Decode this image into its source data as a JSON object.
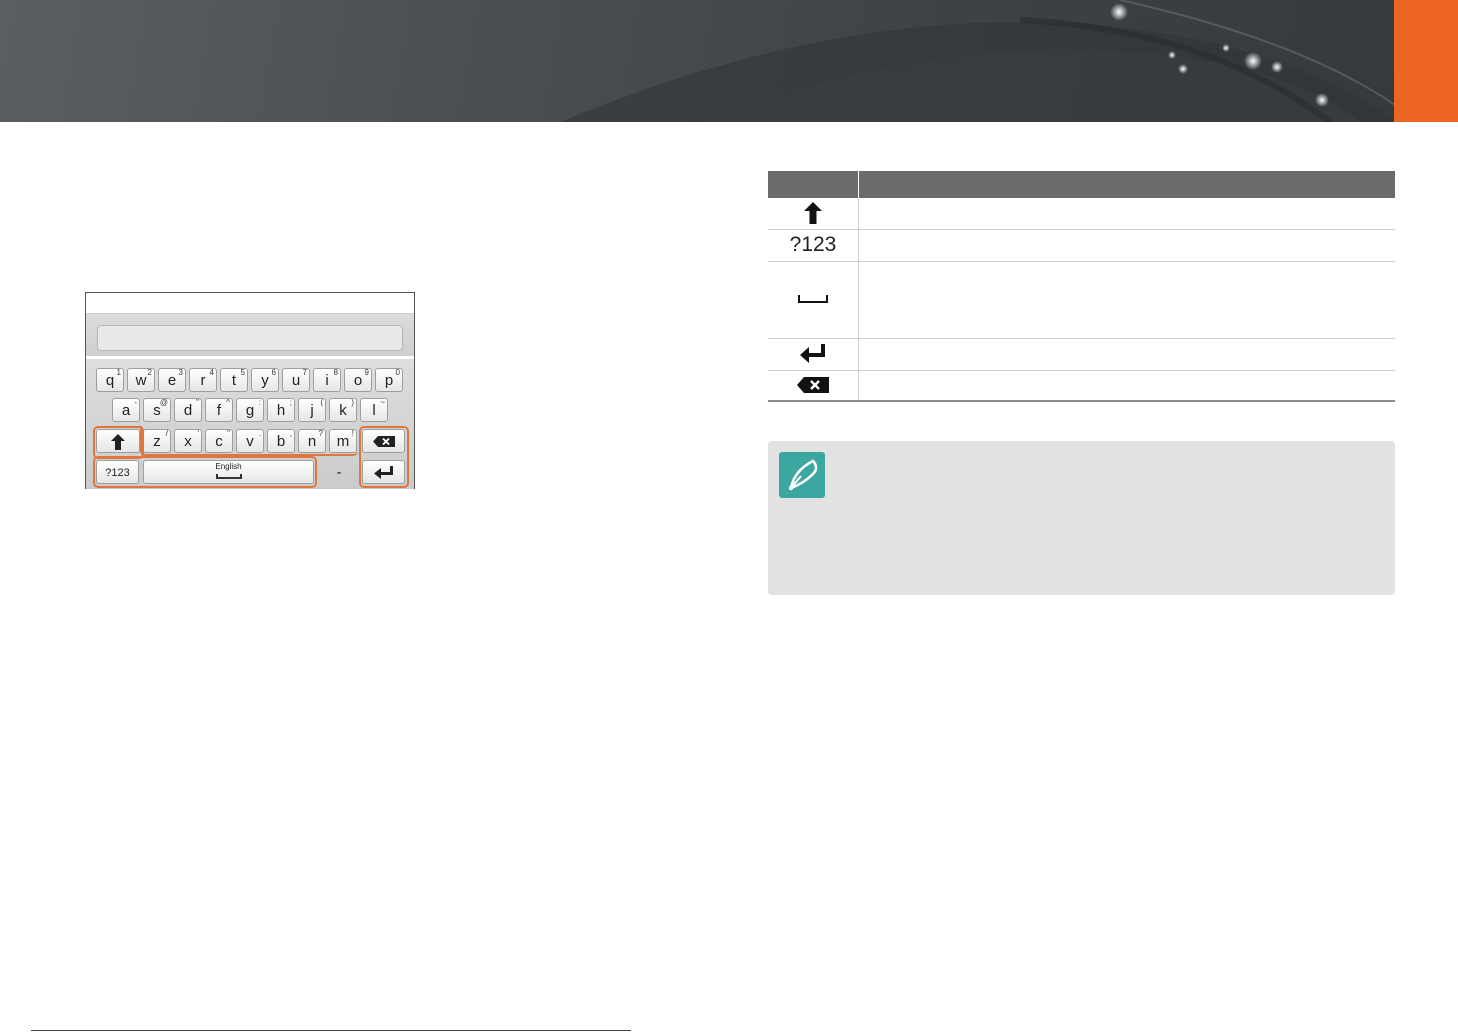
{
  "keyboard": {
    "row1": [
      {
        "key": "q",
        "sup": "1"
      },
      {
        "key": "w",
        "sup": "2"
      },
      {
        "key": "e",
        "sup": "3"
      },
      {
        "key": "r",
        "sup": "4"
      },
      {
        "key": "t",
        "sup": "5"
      },
      {
        "key": "y",
        "sup": "6"
      },
      {
        "key": "u",
        "sup": "7"
      },
      {
        "key": "i",
        "sup": "8"
      },
      {
        "key": "o",
        "sup": "9"
      },
      {
        "key": "p",
        "sup": "0"
      }
    ],
    "row2": [
      {
        "key": "a",
        "sup": "-"
      },
      {
        "key": "s",
        "sup": "@"
      },
      {
        "key": "d",
        "sup": "\""
      },
      {
        "key": "f",
        "sup": "^"
      },
      {
        "key": "g",
        "sup": ":"
      },
      {
        "key": "h",
        "sup": ";"
      },
      {
        "key": "j",
        "sup": "("
      },
      {
        "key": "k",
        "sup": ")"
      },
      {
        "key": "l",
        "sup": "~"
      }
    ],
    "row3": [
      {
        "key": "z",
        "sup": "/"
      },
      {
        "key": "x",
        "sup": "'"
      },
      {
        "key": "c",
        "sup": "\""
      },
      {
        "key": "v",
        "sup": "."
      },
      {
        "key": "b",
        "sup": ","
      },
      {
        "key": "n",
        "sup": "?"
      },
      {
        "key": "m",
        "sup": "!"
      }
    ],
    "numbers_key": "?123",
    "space_language": "English",
    "dash_key": "-",
    "highlight_color": "#e0763d"
  },
  "table": {
    "rows": [
      {
        "icon": "shift-arrow-icon",
        "symbol": ""
      },
      {
        "icon": "",
        "symbol": "?123"
      },
      {
        "icon": "space-bar-icon",
        "symbol": ""
      },
      {
        "icon": "enter-arrow-icon",
        "symbol": ""
      },
      {
        "icon": "backspace-icon",
        "symbol": ""
      }
    ],
    "header_color": "#6b6b6b"
  },
  "note": {
    "icon": "pen-nib-icon",
    "icon_color": "#3ba7a0"
  },
  "banner": {
    "accent_color": "#ec6523"
  }
}
